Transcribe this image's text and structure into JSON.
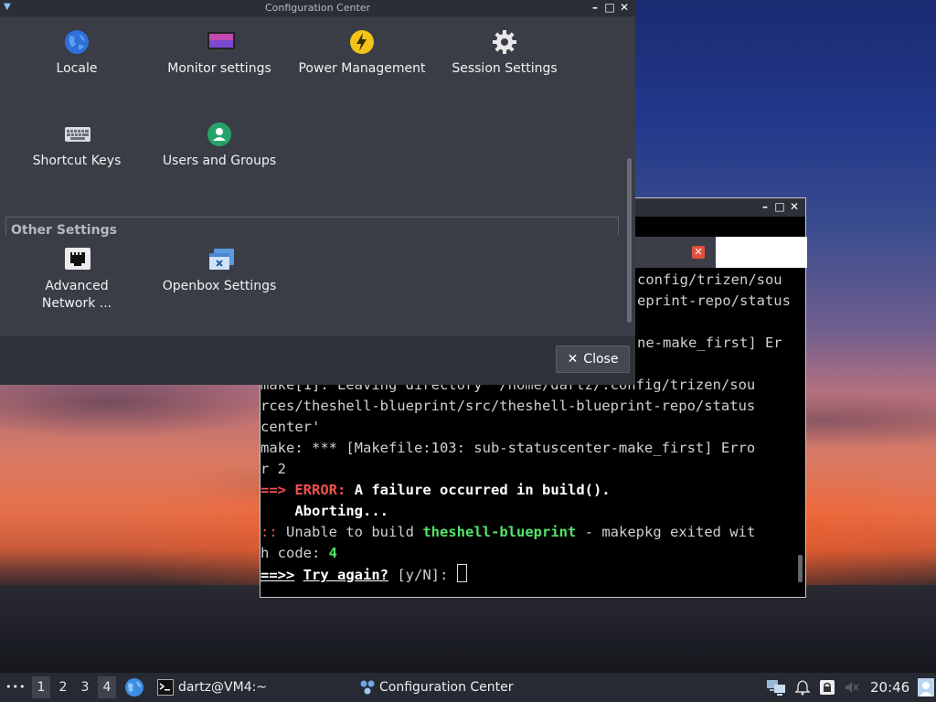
{
  "config_window": {
    "title": "Configuration Center",
    "items": [
      {
        "label": "Locale",
        "icon": "globe-icon"
      },
      {
        "label": "Monitor settings",
        "icon": "monitor-icon"
      },
      {
        "label": "Power Management",
        "icon": "lightning-icon"
      },
      {
        "label": "Session Settings",
        "icon": "gear-icon"
      },
      {
        "label": "Shortcut Keys",
        "icon": "keyboard-icon"
      },
      {
        "label": "Users and Groups",
        "icon": "user-icon"
      }
    ],
    "other_section_title": "Other Settings",
    "other_items": [
      {
        "label": "Advanced\nNetwork ...",
        "icon": "network-icon"
      },
      {
        "label": "Openbox Settings",
        "icon": "windows-icon"
      }
    ],
    "close_label": "Close"
  },
  "terminal": {
    "lines": [
      "config/trizen/sou",
      "eprint-repo/status",
      "",
      "ne-make_first] Er",
      "",
      "make[1]: Leaving directory '/home/dartz/.config/trizen/sou",
      "rces/theshell-blueprint/src/theshell-blueprint-repo/status",
      "center'",
      "make: *** [Makefile:103: sub-statuscenter-make_first] Erro",
      "r 2"
    ],
    "error_arrow": "==>",
    "error_label": "ERROR:",
    "error_message": "A failure occurred in build().",
    "aborting": "Aborting...",
    "unable_prefix": "::",
    "unable_text": "Unable to build",
    "package_name": "theshell-blueprint",
    "unable_suffix": "- makepkg exited wit",
    "exit_code_line": "h code:",
    "exit_code": "4",
    "prompt_arrow": "==>>",
    "prompt_question": "Try again?",
    "prompt_options": "[y/N]:"
  },
  "taskbar": {
    "menu_dots": "•••",
    "workspaces": [
      "1",
      "2",
      "3",
      "4"
    ],
    "active_workspace": "4",
    "terminal_task": "dartz@VM4:~",
    "config_task": "Configuration Center",
    "clock": "20:46"
  },
  "colors": {
    "error_red": "#f0504f",
    "package_green": "#55e36a",
    "window_bg": "#3a3d46"
  }
}
